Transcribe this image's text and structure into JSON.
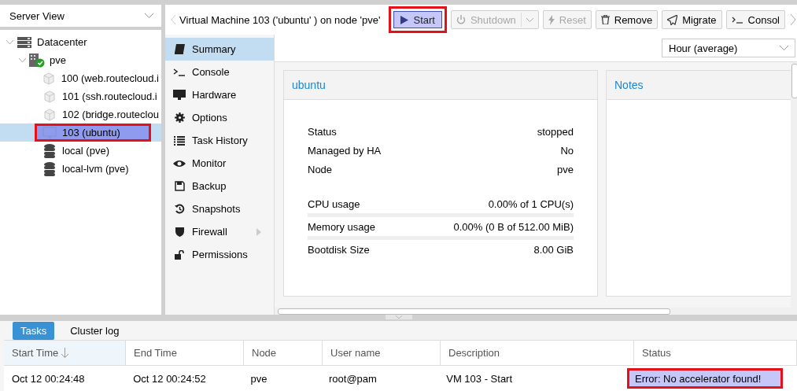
{
  "view_selector": {
    "value": "Server View"
  },
  "tree": [
    {
      "label": "Datacenter",
      "kind": "datacenter",
      "selected": false,
      "expanded": true,
      "children": [
        {
          "label": "pve",
          "kind": "node",
          "selected": false,
          "expanded": true,
          "children": [
            {
              "label": "100 (web.routecloud.i",
              "kind": "container",
              "selected": false,
              "annotated": false
            },
            {
              "label": "101 (ssh.routecloud.i",
              "kind": "container",
              "selected": false,
              "annotated": false
            },
            {
              "label": "102 (bridge.routeclou",
              "kind": "container",
              "selected": false,
              "annotated": false
            },
            {
              "label": "103 (ubuntu)",
              "kind": "vm",
              "selected": true,
              "annotated": true
            },
            {
              "label": "local (pve)",
              "kind": "storage",
              "selected": false,
              "annotated": false
            },
            {
              "label": "local-lvm (pve)",
              "kind": "storage",
              "selected": false,
              "annotated": false
            }
          ]
        }
      ]
    }
  ],
  "header": {
    "title": "Virtual Machine 103 ('ubuntu' ) on node 'pve'",
    "buttons": [
      {
        "label": "Start",
        "kind": "start",
        "disabled": false,
        "pressed": true,
        "annotated": true
      },
      {
        "label": "Shutdown",
        "kind": "shutdown",
        "disabled": true,
        "pressed": false,
        "annotated": false
      },
      {
        "label": "Reset",
        "kind": "reset",
        "disabled": true,
        "pressed": false,
        "annotated": false
      },
      {
        "label": "Remove",
        "kind": "remove",
        "disabled": false,
        "pressed": false,
        "annotated": false
      },
      {
        "label": "Migrate",
        "kind": "migrate",
        "disabled": false,
        "pressed": false,
        "annotated": false
      },
      {
        "label": "Consol",
        "kind": "console",
        "disabled": false,
        "pressed": false,
        "annotated": false
      }
    ]
  },
  "nav": [
    {
      "label": "Summary",
      "kind": "book",
      "selected": true
    },
    {
      "label": "Console",
      "kind": "terminal",
      "selected": false
    },
    {
      "label": "Hardware",
      "kind": "monitor",
      "selected": false
    },
    {
      "label": "Options",
      "kind": "gear",
      "selected": false
    },
    {
      "label": "Task History",
      "kind": "list",
      "selected": false
    },
    {
      "label": "Monitor",
      "kind": "eye",
      "selected": false
    },
    {
      "label": "Backup",
      "kind": "floppy",
      "selected": false
    },
    {
      "label": "Snapshots",
      "kind": "history",
      "selected": false
    },
    {
      "label": "Firewall",
      "kind": "shield",
      "selected": false,
      "expandable": true
    },
    {
      "label": "Permissions",
      "kind": "unlock",
      "selected": false
    }
  ],
  "summary": {
    "timeframe": "Hour (average)",
    "status_panel": {
      "title": "ubuntu",
      "rows": [
        {
          "label": "Status",
          "value": "stopped",
          "kind": "text"
        },
        {
          "label": "Managed by HA",
          "value": "No",
          "kind": "text"
        },
        {
          "label": "Node",
          "value": "pve",
          "kind": "text"
        },
        {
          "label": "CPU usage",
          "value": "0.00% of 1 CPU(s)",
          "kind": "meter",
          "level": 0
        },
        {
          "label": "Memory usage",
          "value": "0.00% (0 B of 512.00 MiB)",
          "kind": "meter",
          "level": 0
        },
        {
          "label": "Bootdisk Size",
          "value": "8.00 GiB",
          "kind": "text"
        }
      ]
    },
    "notes_panel": {
      "title": "Notes"
    }
  },
  "log": {
    "tabs": [
      {
        "label": "Tasks",
        "selected": true
      },
      {
        "label": "Cluster log",
        "selected": false
      }
    ],
    "columns": [
      {
        "label": "Start Time",
        "sorted": true
      },
      {
        "label": "End Time",
        "sorted": false
      },
      {
        "label": "Node",
        "sorted": false
      },
      {
        "label": "User name",
        "sorted": false
      },
      {
        "label": "Description",
        "sorted": false
      },
      {
        "label": "Status",
        "sorted": false
      }
    ],
    "rows": [
      {
        "cells": [
          {
            "text": "Oct 12 00:24:48",
            "annotated": false
          },
          {
            "text": "Oct 12 00:24:52",
            "annotated": false
          },
          {
            "text": "pve",
            "annotated": false
          },
          {
            "text": "root@pam",
            "annotated": false
          },
          {
            "text": "VM 103 - Start",
            "annotated": false
          },
          {
            "text": "Error: No accelerator found!",
            "annotated": true
          }
        ]
      }
    ]
  }
}
